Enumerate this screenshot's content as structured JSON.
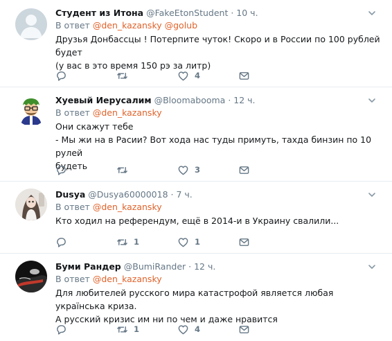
{
  "reply_prefix": "В ответ",
  "tweets": [
    {
      "name": "Студент из Итона",
      "handle": "@FakeEtonStudent",
      "time": "· 10 ч.",
      "reply_to": "@den_kazansky @golub",
      "text_lines": [
        "Друзья Донбассцы ! Потерпите чуток! Скоро и в России по 100 рублей будет",
        "(у вас в это время 150 рэ за литр)"
      ],
      "replies": "",
      "retweets": "",
      "likes": "4"
    },
    {
      "name": "Хуевый Иерусалим",
      "handle": "@Bloomabooma",
      "time": "· 12 ч.",
      "reply_to": "@den_kazansky",
      "text_lines": [
        "Они скажут тебе",
        "- Мы жи на в Расии? Вот хода нас туды примуть, тахда бинзин по 10 рулей",
        "будеть"
      ],
      "replies": "",
      "retweets": "",
      "likes": "3"
    },
    {
      "name": "Dusya",
      "handle": "@Dusya60000018",
      "time": "· 7 ч.",
      "reply_to": "@den_kazansky",
      "text_lines": [
        "Кто ходил на референдум, ещё в 2014-и в Украину свалили..."
      ],
      "replies": "",
      "retweets": "1",
      "likes": "1"
    },
    {
      "name": "Буми Рандер",
      "handle": "@BumiRander",
      "time": "· 12 ч.",
      "reply_to": "@den_kazansky",
      "text_lines": [
        "Для любителей русского мира катастрофой является любая українська криза.",
        "А русский кризис им ни по чем и даже нравится"
      ],
      "replies": "",
      "retweets": "1",
      "likes": "4"
    }
  ],
  "icons": {
    "reply": "reply-icon",
    "retweet": "retweet-icon",
    "like": "heart-icon",
    "message": "direct-message-icon",
    "menu": "chevron-down-icon"
  },
  "colors": {
    "link": "#e0622a",
    "secondary_text": "#657786",
    "divider": "#e6ecf0"
  }
}
